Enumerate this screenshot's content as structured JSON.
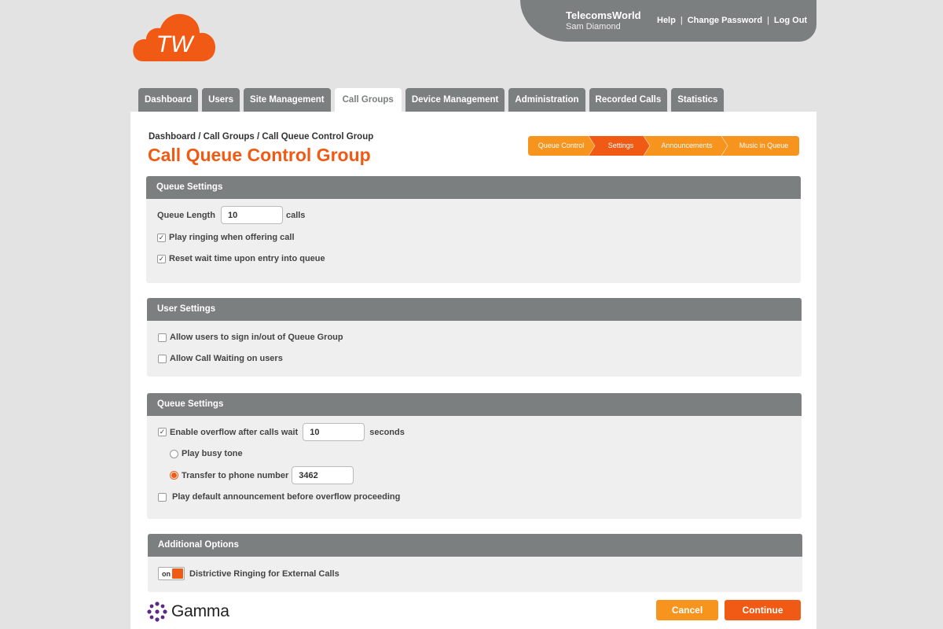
{
  "logo": {
    "text": "TW",
    "color": "#f05a14"
  },
  "userbar": {
    "org": "TelecomsWorld",
    "user": "Sam Diamond",
    "links": [
      "Help",
      "Change Password",
      "Log Out"
    ],
    "separator": "|"
  },
  "tabs": [
    {
      "label": "Dashboard",
      "active": false
    },
    {
      "label": "Users",
      "active": false
    },
    {
      "label": "Site Management",
      "active": false
    },
    {
      "label": "Call Groups",
      "active": true
    },
    {
      "label": "Device Management",
      "active": false
    },
    {
      "label": "Administration",
      "active": false
    },
    {
      "label": "Recorded Calls",
      "active": false
    },
    {
      "label": "Statistics",
      "active": false
    }
  ],
  "breadcrumb": "Dashboard / Call Groups / Call Queue Control Group",
  "page_title": "Call Queue Control Group",
  "steps": [
    {
      "label": "Queue Control",
      "state": "done"
    },
    {
      "label": "Settings",
      "state": "current"
    },
    {
      "label": "Announcements",
      "state": "pending"
    },
    {
      "label": "Music in Queue",
      "state": "pending"
    }
  ],
  "queue_settings": {
    "header": "Queue Settings",
    "queue_length_label": "Queue Length",
    "queue_length_value": "10",
    "queue_length_unit": "calls",
    "play_ringing": {
      "label": "Play ringing when offering call",
      "checked": true
    },
    "reset_wait": {
      "label": "Reset wait time upon entry into queue",
      "checked": true
    }
  },
  "user_settings": {
    "header": "User Settings",
    "allow_sign_in": {
      "label": "Allow users to sign in/out of Queue Group",
      "checked": false
    },
    "allow_call_waiting": {
      "label": "Allow Call Waiting on users",
      "checked": false
    }
  },
  "overflow_settings": {
    "header": "Queue Settings",
    "enable_overflow": {
      "label": "Enable overflow after calls wait",
      "checked": true,
      "value": "10",
      "unit": "seconds"
    },
    "busy_tone": {
      "label": "Play busy tone",
      "selected": false
    },
    "transfer": {
      "label": "Transfer to phone number",
      "selected": true,
      "value": "3462"
    },
    "default_announcement": {
      "label": "Play default announcement before overflow proceeding",
      "checked": false
    }
  },
  "additional_options": {
    "header": "Additional Options",
    "toggle_state": "on",
    "distinctive_ringing": "Districtive Ringing for External Calls"
  },
  "footer": {
    "brand": "Gamma",
    "cancel": "Cancel",
    "continue": "Continue"
  },
  "colors": {
    "accent": "#f05a14",
    "accent_light": "#f7941d",
    "header_grey": "#7b7f7f",
    "background": "#e3e3e3",
    "gamma_purple": "#5b2a86"
  }
}
